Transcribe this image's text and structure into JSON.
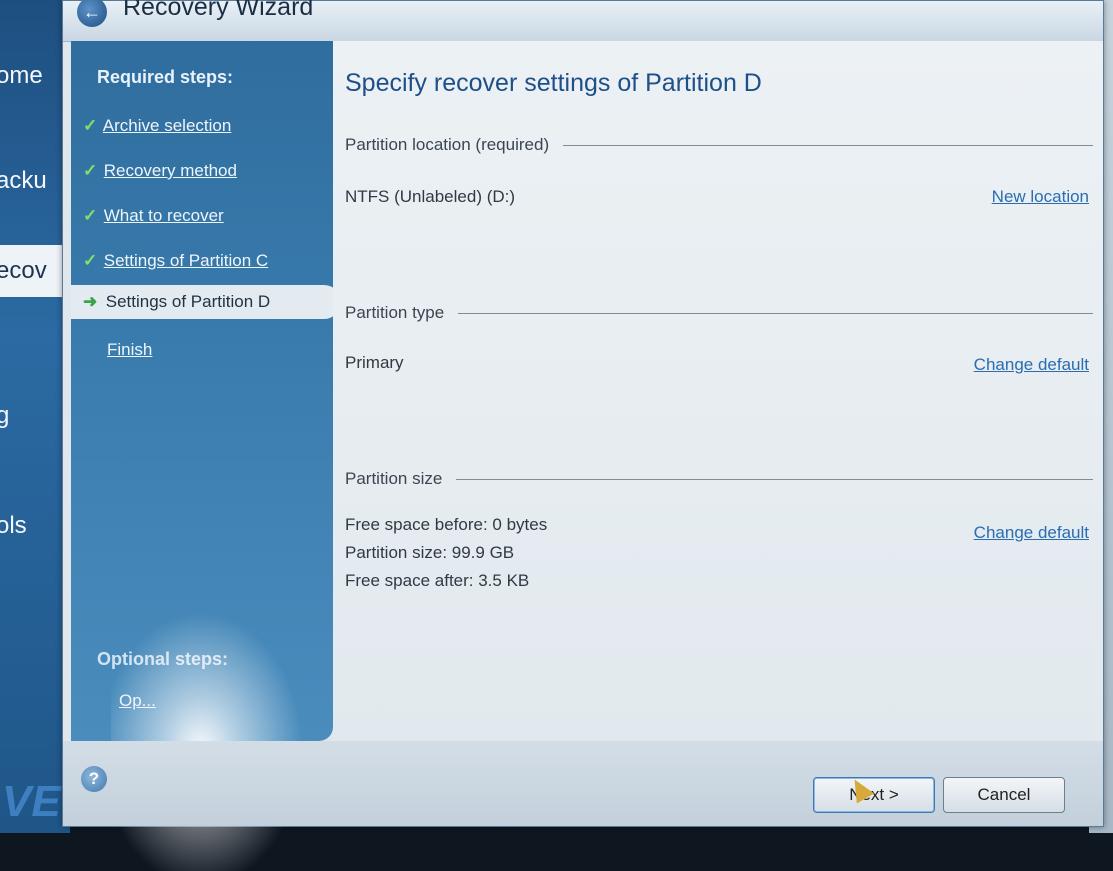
{
  "window": {
    "title": "Recovery Wizard"
  },
  "background_app": {
    "nav_items": [
      "ome",
      "acku",
      "ecov",
      "g",
      "ols"
    ],
    "active_item": "ecov",
    "logo_text": "VE"
  },
  "steps": {
    "heading": "Required steps:",
    "items": [
      {
        "label": "Archive selection",
        "status": "done"
      },
      {
        "label": "Recovery method",
        "status": "done"
      },
      {
        "label": "What to recover",
        "status": "done"
      },
      {
        "label": "Settings of Partition C",
        "status": "done"
      },
      {
        "label": "Settings of Partition D",
        "status": "current"
      },
      {
        "label": "Finish",
        "status": "pending"
      }
    ],
    "optional_heading": "Optional steps:",
    "optional_item": "Op..."
  },
  "main": {
    "title": "Specify recover settings of Partition D",
    "sections": {
      "location": {
        "heading": "Partition location (required)",
        "value": "NTFS (Unlabeled) (D:)",
        "link": "New location"
      },
      "type": {
        "heading": "Partition type",
        "value": "Primary",
        "link": "Change default"
      },
      "size": {
        "heading": "Partition size",
        "free_before": "Free space before: 0 bytes",
        "partition_size": "Partition size: 99.9 GB",
        "free_after": "Free space after: 3.5 KB",
        "link": "Change default"
      }
    }
  },
  "buttons": {
    "next": "Next >",
    "cancel": "Cancel"
  },
  "colors": {
    "step_panel": "#3a7cae",
    "title_blue": "#1d4f88",
    "link": "#2a6db2",
    "check": "#7fe06a"
  }
}
